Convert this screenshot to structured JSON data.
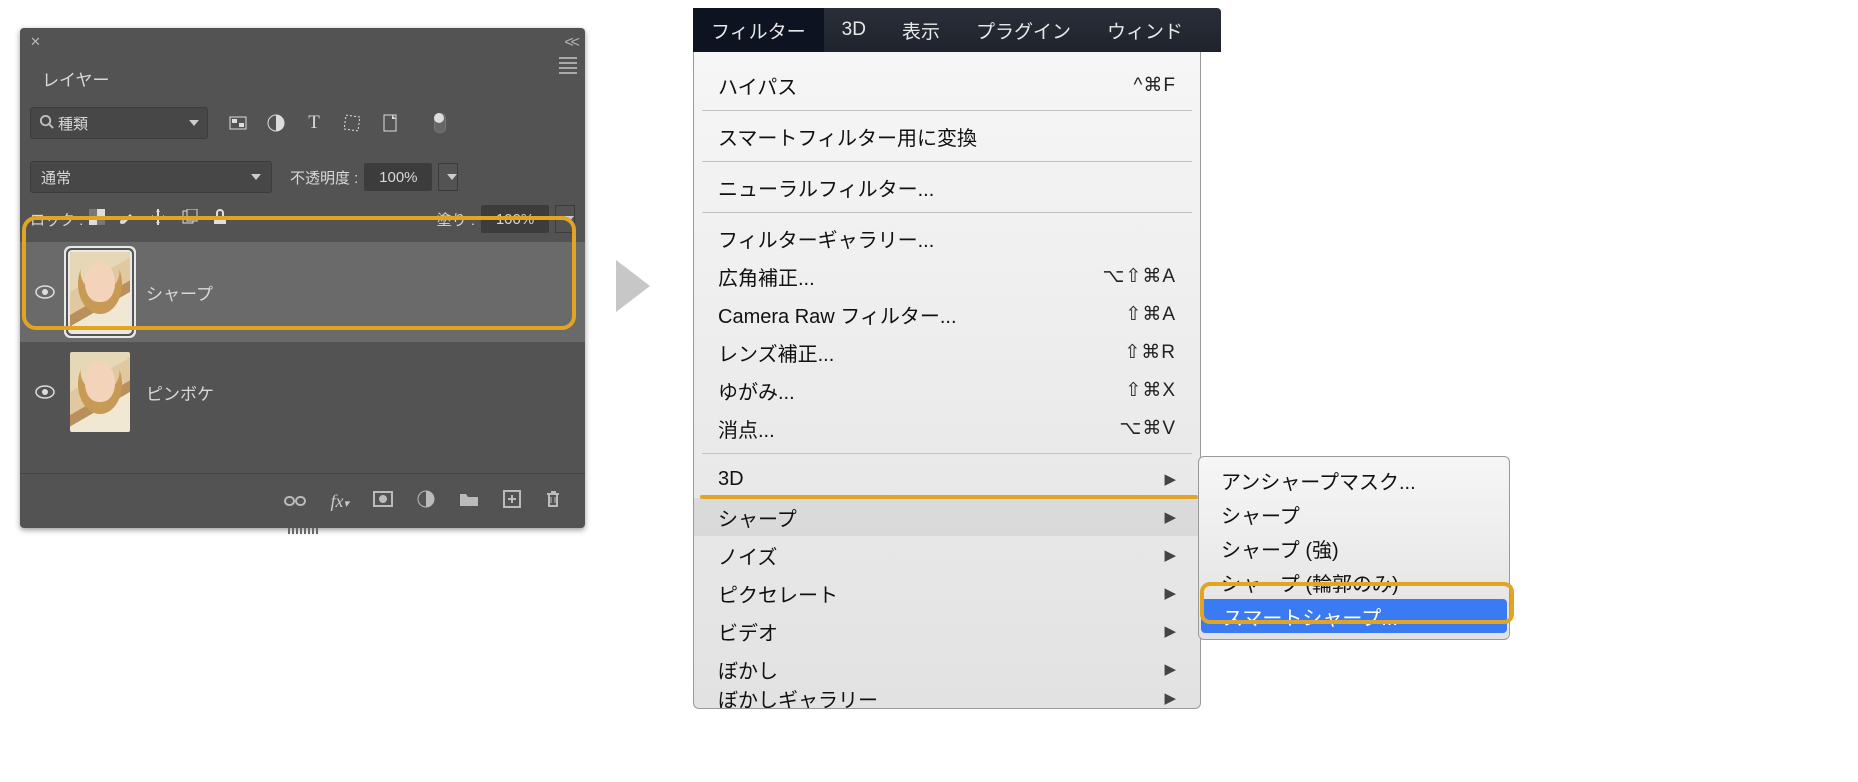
{
  "layers_panel": {
    "tab_title": "レイヤー",
    "kind_label": "種類",
    "blend_mode": "通常",
    "opacity_label": "不透明度 :",
    "opacity_value": "100%",
    "lock_label": "ロック :",
    "fill_label": "塗り :",
    "fill_value": "100%",
    "layers": [
      {
        "name": "シャープ",
        "selected": true,
        "smart_object": true
      },
      {
        "name": "ピンボケ",
        "selected": false,
        "smart_object": false
      }
    ]
  },
  "menubar": {
    "items": [
      "フィルター",
      "3D",
      "表示",
      "プラグイン",
      "ウィンド"
    ],
    "active_index": 0
  },
  "filter_menu": {
    "groups": [
      [
        {
          "label": "ハイパス",
          "shortcut": "^⌘F"
        }
      ],
      [
        {
          "label": "スマートフィルター用に変換"
        }
      ],
      [
        {
          "label": "ニューラルフィルター..."
        }
      ],
      [
        {
          "label": "フィルターギャラリー..."
        },
        {
          "label": "広角補正...",
          "shortcut": "⌥⇧⌘A"
        },
        {
          "label": "Camera Raw フィルター...",
          "shortcut": "⇧⌘A"
        },
        {
          "label": "レンズ補正...",
          "shortcut": "⇧⌘R"
        },
        {
          "label": "ゆがみ...",
          "shortcut": "⇧⌘X"
        },
        {
          "label": "消点...",
          "shortcut": "⌥⌘V"
        }
      ],
      [
        {
          "label": "3D",
          "submenu": true
        },
        {
          "label": "シャープ",
          "submenu": true,
          "highlighted": true
        },
        {
          "label": "ノイズ",
          "submenu": true
        },
        {
          "label": "ピクセレート",
          "submenu": true
        },
        {
          "label": "ビデオ",
          "submenu": true
        },
        {
          "label": "ぼかし",
          "submenu": true
        },
        {
          "label": "ぼかしギャラリー",
          "submenu": true,
          "cut": true
        }
      ]
    ]
  },
  "sharpen_submenu": {
    "items": [
      "アンシャープマスク...",
      "シャープ",
      "シャープ (強)",
      "シャープ (輪郭のみ)",
      "スマートシャープ..."
    ],
    "selected_index": 4
  }
}
